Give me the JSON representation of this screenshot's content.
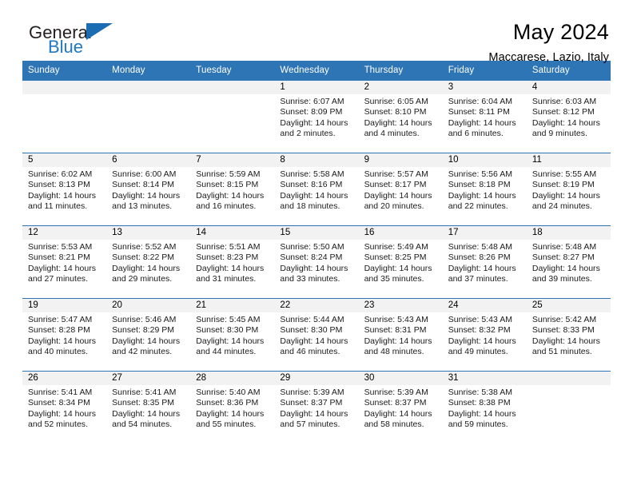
{
  "logo": {
    "word_one": "General",
    "word_two": "Blue",
    "triangle_icon": "triangle-icon",
    "brand_blue": "#1f78c1",
    "brand_dark": "#231f20"
  },
  "header": {
    "title": "May 2024",
    "subtitle": "Maccarese, Lazio, Italy"
  },
  "theme": {
    "header_blue": "#2e75b6",
    "daynum_strip": "#f2f2f2",
    "text": "#000000"
  },
  "weekday_headers": [
    "Sunday",
    "Monday",
    "Tuesday",
    "Wednesday",
    "Thursday",
    "Friday",
    "Saturday"
  ],
  "labels": {
    "sunrise": "Sunrise:",
    "sunset": "Sunset:",
    "daylight": "Daylight:"
  },
  "weeks": [
    [
      {
        "day": "",
        "sunrise": "",
        "sunset": "",
        "daylight": "",
        "empty": true
      },
      {
        "day": "",
        "sunrise": "",
        "sunset": "",
        "daylight": "",
        "empty": true
      },
      {
        "day": "",
        "sunrise": "",
        "sunset": "",
        "daylight": "",
        "empty": true
      },
      {
        "day": "1",
        "sunrise": "Sunrise: 6:07 AM",
        "sunset": "Sunset: 8:09 PM",
        "daylight": "Daylight: 14 hours and 2 minutes."
      },
      {
        "day": "2",
        "sunrise": "Sunrise: 6:05 AM",
        "sunset": "Sunset: 8:10 PM",
        "daylight": "Daylight: 14 hours and 4 minutes."
      },
      {
        "day": "3",
        "sunrise": "Sunrise: 6:04 AM",
        "sunset": "Sunset: 8:11 PM",
        "daylight": "Daylight: 14 hours and 6 minutes."
      },
      {
        "day": "4",
        "sunrise": "Sunrise: 6:03 AM",
        "sunset": "Sunset: 8:12 PM",
        "daylight": "Daylight: 14 hours and 9 minutes."
      }
    ],
    [
      {
        "day": "5",
        "sunrise": "Sunrise: 6:02 AM",
        "sunset": "Sunset: 8:13 PM",
        "daylight": "Daylight: 14 hours and 11 minutes."
      },
      {
        "day": "6",
        "sunrise": "Sunrise: 6:00 AM",
        "sunset": "Sunset: 8:14 PM",
        "daylight": "Daylight: 14 hours and 13 minutes."
      },
      {
        "day": "7",
        "sunrise": "Sunrise: 5:59 AM",
        "sunset": "Sunset: 8:15 PM",
        "daylight": "Daylight: 14 hours and 16 minutes."
      },
      {
        "day": "8",
        "sunrise": "Sunrise: 5:58 AM",
        "sunset": "Sunset: 8:16 PM",
        "daylight": "Daylight: 14 hours and 18 minutes."
      },
      {
        "day": "9",
        "sunrise": "Sunrise: 5:57 AM",
        "sunset": "Sunset: 8:17 PM",
        "daylight": "Daylight: 14 hours and 20 minutes."
      },
      {
        "day": "10",
        "sunrise": "Sunrise: 5:56 AM",
        "sunset": "Sunset: 8:18 PM",
        "daylight": "Daylight: 14 hours and 22 minutes."
      },
      {
        "day": "11",
        "sunrise": "Sunrise: 5:55 AM",
        "sunset": "Sunset: 8:19 PM",
        "daylight": "Daylight: 14 hours and 24 minutes."
      }
    ],
    [
      {
        "day": "12",
        "sunrise": "Sunrise: 5:53 AM",
        "sunset": "Sunset: 8:21 PM",
        "daylight": "Daylight: 14 hours and 27 minutes."
      },
      {
        "day": "13",
        "sunrise": "Sunrise: 5:52 AM",
        "sunset": "Sunset: 8:22 PM",
        "daylight": "Daylight: 14 hours and 29 minutes."
      },
      {
        "day": "14",
        "sunrise": "Sunrise: 5:51 AM",
        "sunset": "Sunset: 8:23 PM",
        "daylight": "Daylight: 14 hours and 31 minutes."
      },
      {
        "day": "15",
        "sunrise": "Sunrise: 5:50 AM",
        "sunset": "Sunset: 8:24 PM",
        "daylight": "Daylight: 14 hours and 33 minutes."
      },
      {
        "day": "16",
        "sunrise": "Sunrise: 5:49 AM",
        "sunset": "Sunset: 8:25 PM",
        "daylight": "Daylight: 14 hours and 35 minutes."
      },
      {
        "day": "17",
        "sunrise": "Sunrise: 5:48 AM",
        "sunset": "Sunset: 8:26 PM",
        "daylight": "Daylight: 14 hours and 37 minutes."
      },
      {
        "day": "18",
        "sunrise": "Sunrise: 5:48 AM",
        "sunset": "Sunset: 8:27 PM",
        "daylight": "Daylight: 14 hours and 39 minutes."
      }
    ],
    [
      {
        "day": "19",
        "sunrise": "Sunrise: 5:47 AM",
        "sunset": "Sunset: 8:28 PM",
        "daylight": "Daylight: 14 hours and 40 minutes."
      },
      {
        "day": "20",
        "sunrise": "Sunrise: 5:46 AM",
        "sunset": "Sunset: 8:29 PM",
        "daylight": "Daylight: 14 hours and 42 minutes."
      },
      {
        "day": "21",
        "sunrise": "Sunrise: 5:45 AM",
        "sunset": "Sunset: 8:30 PM",
        "daylight": "Daylight: 14 hours and 44 minutes."
      },
      {
        "day": "22",
        "sunrise": "Sunrise: 5:44 AM",
        "sunset": "Sunset: 8:30 PM",
        "daylight": "Daylight: 14 hours and 46 minutes."
      },
      {
        "day": "23",
        "sunrise": "Sunrise: 5:43 AM",
        "sunset": "Sunset: 8:31 PM",
        "daylight": "Daylight: 14 hours and 48 minutes."
      },
      {
        "day": "24",
        "sunrise": "Sunrise: 5:43 AM",
        "sunset": "Sunset: 8:32 PM",
        "daylight": "Daylight: 14 hours and 49 minutes."
      },
      {
        "day": "25",
        "sunrise": "Sunrise: 5:42 AM",
        "sunset": "Sunset: 8:33 PM",
        "daylight": "Daylight: 14 hours and 51 minutes."
      }
    ],
    [
      {
        "day": "26",
        "sunrise": "Sunrise: 5:41 AM",
        "sunset": "Sunset: 8:34 PM",
        "daylight": "Daylight: 14 hours and 52 minutes."
      },
      {
        "day": "27",
        "sunrise": "Sunrise: 5:41 AM",
        "sunset": "Sunset: 8:35 PM",
        "daylight": "Daylight: 14 hours and 54 minutes."
      },
      {
        "day": "28",
        "sunrise": "Sunrise: 5:40 AM",
        "sunset": "Sunset: 8:36 PM",
        "daylight": "Daylight: 14 hours and 55 minutes."
      },
      {
        "day": "29",
        "sunrise": "Sunrise: 5:39 AM",
        "sunset": "Sunset: 8:37 PM",
        "daylight": "Daylight: 14 hours and 57 minutes."
      },
      {
        "day": "30",
        "sunrise": "Sunrise: 5:39 AM",
        "sunset": "Sunset: 8:37 PM",
        "daylight": "Daylight: 14 hours and 58 minutes."
      },
      {
        "day": "31",
        "sunrise": "Sunrise: 5:38 AM",
        "sunset": "Sunset: 8:38 PM",
        "daylight": "Daylight: 14 hours and 59 minutes."
      },
      {
        "day": "",
        "sunrise": "",
        "sunset": "",
        "daylight": "",
        "empty": true
      }
    ]
  ]
}
